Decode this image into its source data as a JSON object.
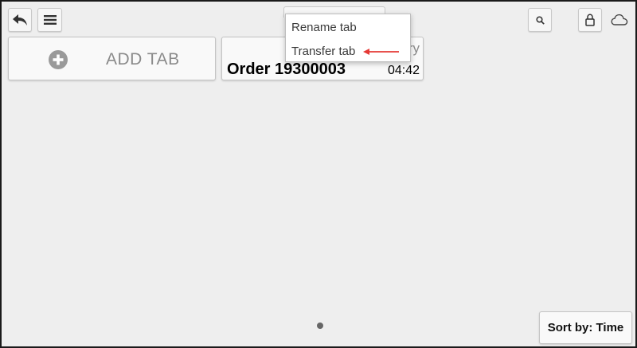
{
  "toolbar": {
    "back_icon": "back-arrow-icon",
    "menu_icon": "hamburger-menu-icon",
    "search_icon": "search-icon",
    "lock_icon": "lock-icon",
    "cloud_icon": "cloud-icon"
  },
  "tabs": {
    "add_tab_label": "ADD TAB",
    "order": {
      "partial_label": "ry",
      "title": "Order 19300003",
      "time": "04:42"
    }
  },
  "context_menu": {
    "items": [
      {
        "label": "Rename tab"
      },
      {
        "label": "Transfer tab"
      }
    ],
    "annotation_color": "#e53935"
  },
  "footer": {
    "sort_label": "Sort by: Time"
  },
  "colors": {
    "background": "#eeeeee",
    "tile": "#f9f9f9",
    "muted_text": "#8a8a8a"
  }
}
